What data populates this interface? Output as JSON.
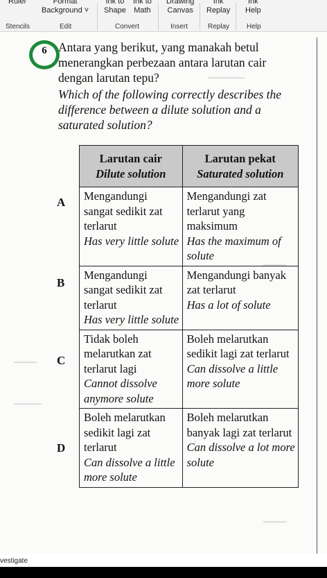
{
  "ribbon": {
    "buttons": [
      {
        "line1": "Ruler",
        "line2": ""
      },
      {
        "line1": "Format",
        "line2": "Background ˅"
      },
      {
        "line1": "Ink to",
        "line2": "Shape"
      },
      {
        "line1": "Ink to",
        "line2": "Math"
      },
      {
        "line1": "Drawing",
        "line2": "Canvas"
      },
      {
        "line1": "Ink",
        "line2": "Replay"
      },
      {
        "line1": "Ink",
        "line2": "Help"
      }
    ],
    "groups": [
      "Stencils",
      "Edit",
      "Convert",
      "Insert",
      "Replay",
      "Help"
    ]
  },
  "question": {
    "number": "6",
    "text_ms": "Antara yang berikut, yang manakah betul menerangkan perbezaan antara larutan cair dengan larutan tepu?",
    "text_en": "Which of the following correctly describes the difference between a dilute solution and a saturated solution?"
  },
  "table": {
    "headers": [
      {
        "ms": "Larutan cair",
        "en": "Dilute solution"
      },
      {
        "ms": "Larutan pekat",
        "en": "Saturated solution"
      }
    ],
    "rows": [
      {
        "letter": "A",
        "col1_ms": "Mengandungi sangat sedikit zat terlarut",
        "col1_en": "Has very little solute",
        "col2_ms": "Mengandungi zat terlarut yang maksimum",
        "col2_en": "Has the maximum of solute"
      },
      {
        "letter": "B",
        "col1_ms": "Mengandungi sangat sedikit zat terlarut",
        "col1_en": "Has very little solute",
        "col2_ms": "Mengandungi banyak zat terlarut",
        "col2_en": "Has a lot of solute"
      },
      {
        "letter": "C",
        "col1_ms": "Tidak boleh melarutkan zat terlarut lagi",
        "col1_en": "Cannot dissolve anymore solute",
        "col2_ms": "Boleh melarutkan sedikit lagi zat terlarut",
        "col2_en": "Can dissolve a little more solute"
      },
      {
        "letter": "D",
        "col1_ms": "Boleh melarutkan sedikit lagi zat terlarut",
        "col1_en": "Can dissolve a little more solute",
        "col2_ms": "Boleh melarutkan banyak lagi zat terlarut",
        "col2_en": "Can dissolve a lot more solute"
      }
    ]
  },
  "status": {
    "tooltip": "vestigate"
  }
}
